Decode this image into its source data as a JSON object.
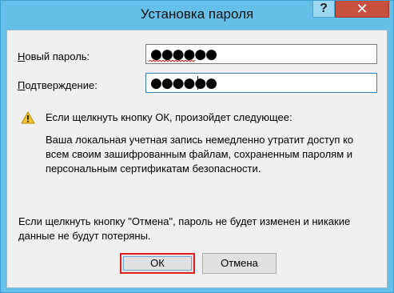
{
  "window": {
    "title": "Установка пароля",
    "help_glyph": "?",
    "close_glyph": "✕"
  },
  "form": {
    "new_password": {
      "label_accel": "Н",
      "label_rest": "овый пароль:",
      "value_mask": "●●●●●●"
    },
    "confirm_password": {
      "label_accel": "П",
      "label_rest": "одтверждение:",
      "value_mask": "●●●●●●"
    }
  },
  "warning": {
    "icon": "warning-triangle-icon",
    "heading": "Если щелкнуть кнопку ОК, произойдет следующее:",
    "body": "Ваша локальная учетная запись немедленно утратит доступ ко всем своим зашифрованным файлам, сохраненным паролям и персональным сертификатам безопасности."
  },
  "cancel_note": "Если щелкнуть кнопку \"Отмена\", пароль не будет изменен и никакие данные не будут потеряны.",
  "buttons": {
    "ok": "ОК",
    "cancel": "Отмена"
  },
  "colors": {
    "title_bar": "#64c0e9",
    "close_button": "#c7503f",
    "highlight_outline": "#e02020"
  }
}
